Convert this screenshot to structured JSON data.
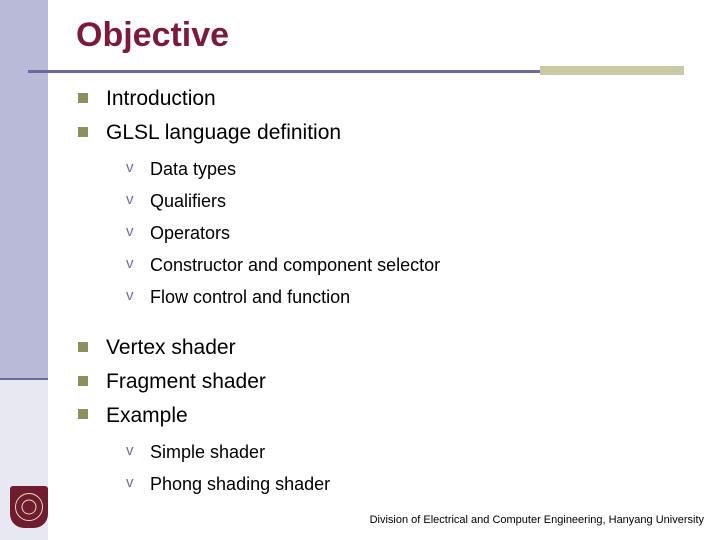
{
  "slide": {
    "title": "Objective",
    "title_color": "#7d1a3c",
    "accent_color": "#6a6aa0",
    "bullet_color": "#8f8f5e",
    "outline": [
      {
        "level": 1,
        "text": "Introduction",
        "bullet": "square-bullet"
      },
      {
        "level": 1,
        "text": "GLSL language definition",
        "bullet": "square-bullet"
      },
      {
        "level": 2,
        "text": "Data types",
        "bullet": "v-bullet"
      },
      {
        "level": 2,
        "text": "Qualifiers",
        "bullet": "v-bullet"
      },
      {
        "level": 2,
        "text": "Operators",
        "bullet": "v-bullet"
      },
      {
        "level": 2,
        "text": "Constructor and component selector",
        "bullet": "v-bullet"
      },
      {
        "level": 2,
        "text": "Flow control and function",
        "bullet": "v-bullet"
      },
      {
        "level": 1,
        "text": "Vertex shader",
        "bullet": "square-bullet"
      },
      {
        "level": 1,
        "text": "Fragment shader",
        "bullet": "square-bullet"
      },
      {
        "level": 1,
        "text": "Example",
        "bullet": "square-bullet"
      },
      {
        "level": 2,
        "text": "Simple shader",
        "bullet": "v-bullet"
      },
      {
        "level": 2,
        "text": "Phong shading shader",
        "bullet": "v-bullet"
      }
    ],
    "bullet_glyph_level2": "v",
    "footer": "Division of Electrical and Computer Engineering, Hanyang University",
    "logo": "hanyang-university-emblem"
  }
}
